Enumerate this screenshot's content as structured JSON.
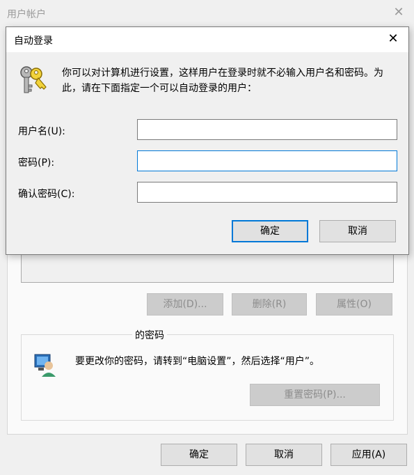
{
  "background_window": {
    "title": "用户帐户",
    "buttons": {
      "add": "添加(D)...",
      "remove": "删除(R)",
      "properties": "属性(O)"
    },
    "password_section": {
      "label": "的密码",
      "message": "要更改你的密码，请转到“电脑设置”，然后选择“用户”。",
      "reset_button": "重置密码(P)..."
    },
    "footer": {
      "ok": "确定",
      "cancel": "取消",
      "apply": "应用(A)"
    }
  },
  "dialog": {
    "title": "自动登录",
    "description": "你可以对计算机进行设置，这样用户在登录时就不必输入用户名和密码。为此，请在下面指定一个可以自动登录的用户：",
    "fields": {
      "username_label": "用户名(U):",
      "password_label": "密码(P):",
      "confirm_label": "确认密码(C):"
    },
    "buttons": {
      "ok": "确定",
      "cancel": "取消"
    }
  },
  "colors": {
    "accent": "#0078d7",
    "disabled_text": "#8c8c8c"
  }
}
